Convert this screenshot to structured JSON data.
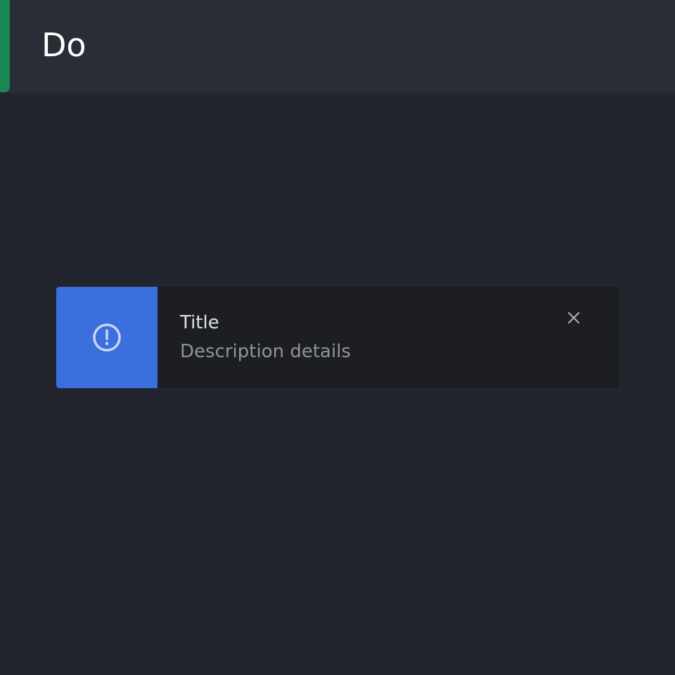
{
  "header": {
    "title": "Do",
    "accent_color": "#198754"
  },
  "toast": {
    "icon": "exclamation-circle-icon",
    "accent_color": "#3c6fde",
    "title": "Title",
    "description": "Description details",
    "close_icon": "close-icon"
  }
}
